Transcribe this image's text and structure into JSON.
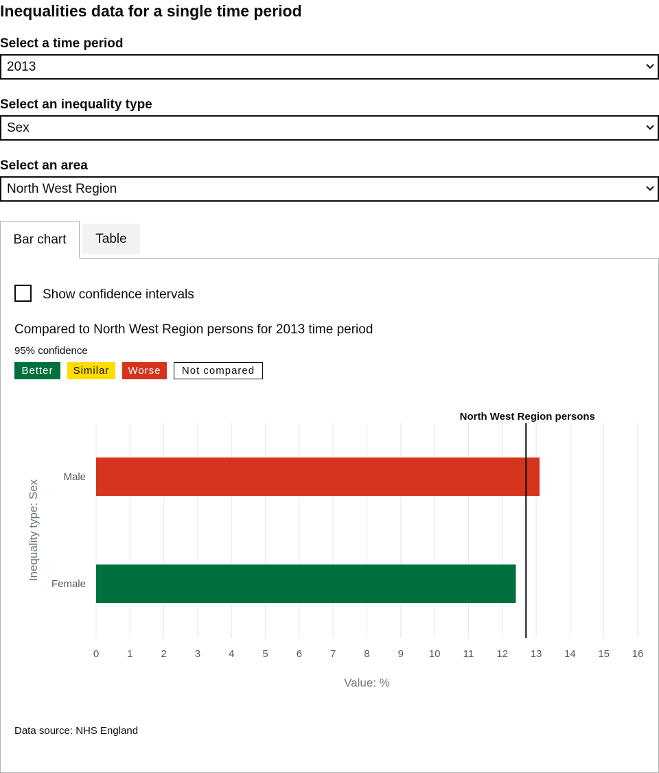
{
  "page": {
    "title": "Inequalities data for a single time period"
  },
  "filters": {
    "time_period": {
      "label": "Select a time period",
      "value": "2013"
    },
    "inequality_type": {
      "label": "Select an inequality type",
      "value": "Sex"
    },
    "area": {
      "label": "Select an area",
      "value": "North West Region"
    }
  },
  "tabs": [
    {
      "label": "Bar chart",
      "active": true
    },
    {
      "label": "Table",
      "active": false
    }
  ],
  "panel": {
    "confidence_toggle_label": "Show confidence intervals",
    "comparison_text": "Compared to North West Region persons for 2013 time period",
    "confidence_text": "95% confidence",
    "legend": [
      {
        "label": "Better",
        "color": "#00703c",
        "text_color": "#ffffff"
      },
      {
        "label": "Similar",
        "color": "#ffdd00",
        "text_color": "#0b0c0c"
      },
      {
        "label": "Worse",
        "color": "#d4351c",
        "text_color": "#ffffff"
      },
      {
        "label": "Not compared",
        "color": "#ffffff",
        "text_color": "#0b0c0c"
      }
    ],
    "data_source": "Data source: NHS England"
  },
  "chart_data": {
    "type": "bar",
    "orientation": "horizontal",
    "categories": [
      "Male",
      "Female"
    ],
    "values": [
      13.1,
      12.4
    ],
    "bar_colors": [
      "#d4351c",
      "#00703c"
    ],
    "benchmark": {
      "label": "North West Region persons",
      "value": 12.7
    },
    "xlabel": "Value: %",
    "ylabel": "Inequality type: Sex",
    "xlim": [
      0,
      16
    ],
    "xticks": [
      0,
      1,
      2,
      3,
      4,
      5,
      6,
      7,
      8,
      9,
      10,
      11,
      12,
      13,
      14,
      15,
      16
    ],
    "grid": true
  }
}
